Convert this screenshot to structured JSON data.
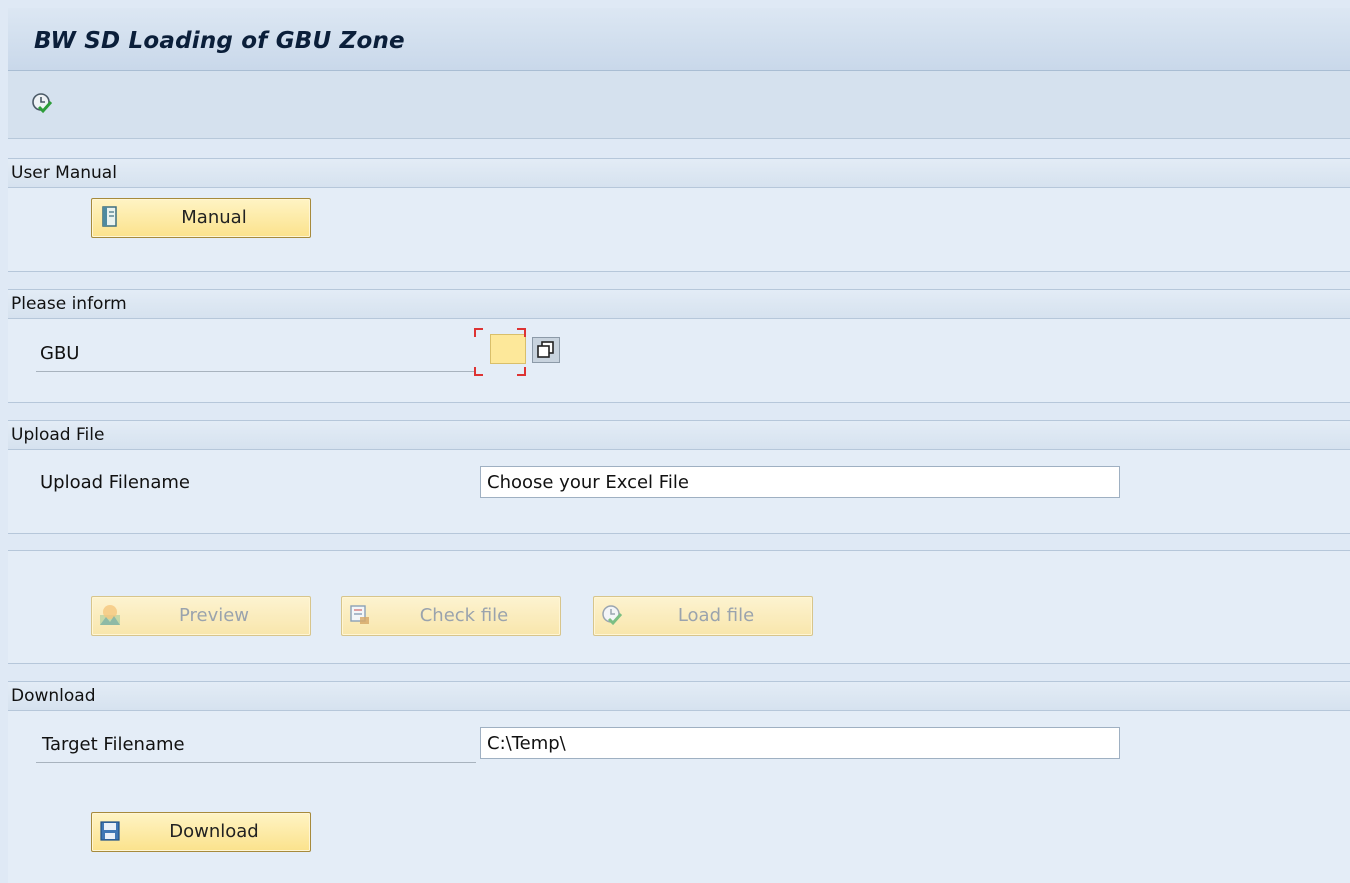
{
  "window": {
    "title": "BW SD Loading of GBU Zone"
  },
  "toolbar": {
    "icons": [
      "execute-icon"
    ]
  },
  "user_manual": {
    "header": "User Manual",
    "manual_button": {
      "label": "Manual",
      "icon": "manual-icon"
    }
  },
  "please_inform": {
    "header": "Please inform",
    "gbu_label": "GBU",
    "gbu_value": ""
  },
  "upload_file": {
    "header": "Upload File",
    "filename_label": "Upload Filename",
    "filename_value": "Choose your Excel File"
  },
  "actions": {
    "preview": {
      "label": "Preview",
      "icon": "preview-icon",
      "enabled": false
    },
    "check": {
      "label": "Check file",
      "icon": "check-file-icon",
      "enabled": false
    },
    "load": {
      "label": "Load file",
      "icon": "load-file-icon",
      "enabled": false
    }
  },
  "download": {
    "header": "Download",
    "target_label": "Target Filename",
    "target_value": "C:\\Temp\\",
    "download_button": {
      "label": "Download",
      "icon": "save-icon"
    }
  }
}
